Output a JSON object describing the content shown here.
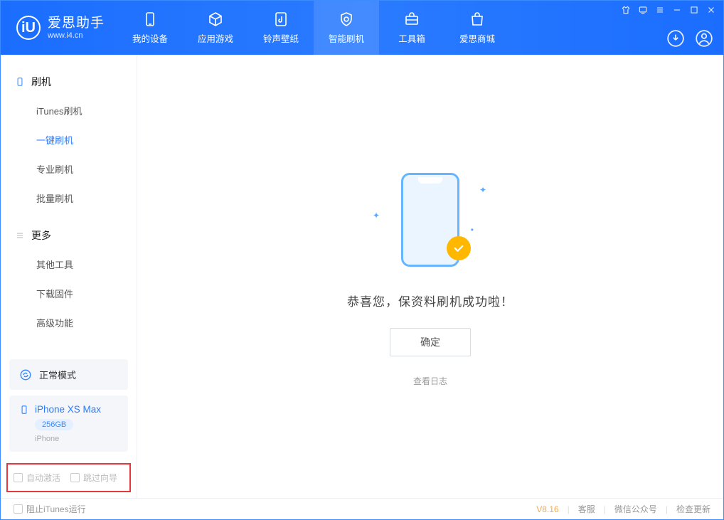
{
  "app": {
    "name_cn": "爱思助手",
    "url": "www.i4.cn"
  },
  "topnav": [
    {
      "label": "我的设备"
    },
    {
      "label": "应用游戏"
    },
    {
      "label": "铃声壁纸"
    },
    {
      "label": "智能刷机"
    },
    {
      "label": "工具箱"
    },
    {
      "label": "爱思商城"
    }
  ],
  "sidebar": {
    "group1_title": "刷机",
    "group1_items": [
      {
        "label": "iTunes刷机"
      },
      {
        "label": "一键刷机"
      },
      {
        "label": "专业刷机"
      },
      {
        "label": "批量刷机"
      }
    ],
    "group2_title": "更多",
    "group2_items": [
      {
        "label": "其他工具"
      },
      {
        "label": "下载固件"
      },
      {
        "label": "高级功能"
      }
    ],
    "mode_label": "正常模式",
    "device_name": "iPhone XS Max",
    "device_capacity": "256GB",
    "device_type": "iPhone",
    "check_auto_activate": "自动激活",
    "check_skip_guide": "跳过向导"
  },
  "main": {
    "success_text": "恭喜您，保资料刷机成功啦！",
    "ok_button": "确定",
    "view_log": "查看日志"
  },
  "footer": {
    "block_itunes": "阻止iTunes运行",
    "version": "V8.16",
    "link_support": "客服",
    "link_wechat": "微信公众号",
    "link_update": "检查更新"
  }
}
